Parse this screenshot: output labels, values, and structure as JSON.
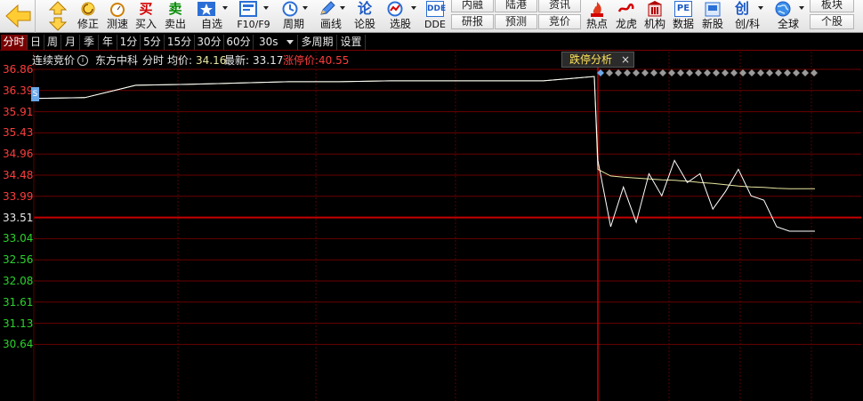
{
  "toolbar": {
    "buttons": [
      {
        "label": "修正",
        "icon": "refresh-icon"
      },
      {
        "label": "测速",
        "icon": "stopwatch-icon"
      },
      {
        "label": "买入",
        "icon": "buy-icon",
        "glyph": "买"
      },
      {
        "label": "卖出",
        "icon": "sell-icon",
        "glyph": "卖"
      },
      {
        "label": "自选",
        "icon": "favorite-star-icon"
      },
      {
        "label": "F10/F9",
        "icon": "f10-icon"
      },
      {
        "label": "周期",
        "icon": "clock-icon"
      },
      {
        "label": "画线",
        "icon": "pencil-icon"
      },
      {
        "label": "论股",
        "icon": "discuss-icon",
        "glyph": "论"
      },
      {
        "label": "选股",
        "icon": "stock-picker-icon"
      },
      {
        "label": "DDE",
        "icon": "dde-icon",
        "glyph": "DDE"
      },
      {
        "label": "热点",
        "icon": "hot-icon"
      },
      {
        "label": "龙虎",
        "icon": "dragon-tiger-icon"
      },
      {
        "label": "机构",
        "icon": "institution-icon"
      },
      {
        "label": "数据",
        "icon": "data-icon",
        "glyph": "PE"
      },
      {
        "label": "新股",
        "icon": "new-stock-icon"
      },
      {
        "label": "创/科",
        "icon": "chuang-icon",
        "glyph": "创"
      },
      {
        "label": "全球",
        "icon": "globe-icon"
      }
    ],
    "pairs": [
      {
        "top": "内融",
        "bottom": "研报"
      },
      {
        "top": "陆港",
        "bottom": "预测"
      },
      {
        "top": "资讯",
        "bottom": "竞价"
      }
    ],
    "sector": {
      "top": "板块",
      "bottom": "个股"
    }
  },
  "periods": [
    "分时",
    "日",
    "周",
    "月",
    "季",
    "年",
    "1分",
    "5分",
    "15分",
    "30分",
    "60分",
    "30s",
    "多周期",
    "设置"
  ],
  "active_period": "分时",
  "chart_header": {
    "auction": "连续竞价",
    "name": "东方中科",
    "mode": "分时",
    "avg_label": "均价:",
    "avg_value": "34.16",
    "last_label": "最新:",
    "last_value": "33.17",
    "limit_label": "涨停价:",
    "limit_value": "40.55",
    "limit_popup": "跌停分析"
  },
  "colors": {
    "up": "#ff3c3c",
    "down": "#2bd42b",
    "neutral": "#e8e8e8",
    "price_line": "#ffffff",
    "avg_line": "#e8e6a0",
    "grid": "#6a0000"
  },
  "chart_data": {
    "type": "line",
    "yticks": [
      "36.86",
      "36.39",
      "35.91",
      "35.43",
      "34.96",
      "34.48",
      "33.99",
      "33.51",
      "33.04",
      "32.56",
      "32.08",
      "31.61",
      "31.13",
      "30.64"
    ],
    "prev_close": 33.51,
    "ylim": [
      30.16,
      36.86
    ],
    "series": [
      {
        "name": "price",
        "values": [
          36.2,
          36.22,
          36.5,
          36.52,
          36.55,
          36.58,
          36.58,
          36.6,
          36.6,
          36.6,
          36.6,
          36.7,
          34.8,
          33.3,
          34.2,
          33.4,
          34.5,
          34.0,
          34.8,
          34.3,
          34.5,
          33.7,
          34.1,
          34.6,
          34.0,
          33.9,
          33.3,
          33.2,
          33.2,
          33.2
        ]
      },
      {
        "name": "avg",
        "values": [
          36.2,
          36.22,
          36.5,
          36.52,
          36.55,
          36.58,
          36.58,
          36.6,
          36.6,
          36.6,
          36.6,
          36.7,
          34.6,
          34.45,
          34.42,
          34.4,
          34.38,
          34.36,
          34.35,
          34.33,
          34.3,
          34.28,
          34.25,
          34.22,
          34.2,
          34.19,
          34.17,
          34.16,
          34.16,
          34.16
        ]
      }
    ]
  }
}
